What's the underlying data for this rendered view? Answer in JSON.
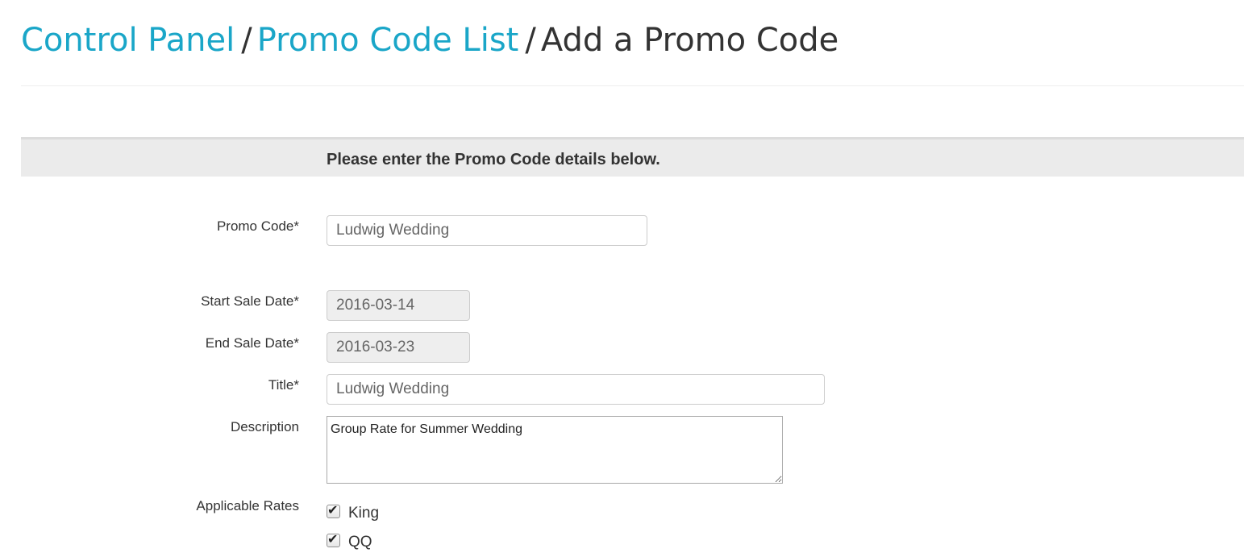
{
  "breadcrumb": {
    "control_panel": "Control Panel",
    "separator": "/",
    "promo_code_list": "Promo Code List",
    "current": "Add a Promo Code"
  },
  "section": {
    "heading": "Please enter the Promo Code details below."
  },
  "form": {
    "promo_code": {
      "label": "Promo Code*",
      "value": "Ludwig Wedding"
    },
    "start_sale_date": {
      "label": "Start Sale Date*",
      "value": "2016-03-14"
    },
    "end_sale_date": {
      "label": "End Sale Date*",
      "value": "2016-03-23"
    },
    "title": {
      "label": "Title*",
      "value": "Ludwig Wedding"
    },
    "description": {
      "label": "Description",
      "value": "Group Rate for Summer Wedding"
    },
    "applicable_rates": {
      "label": "Applicable Rates",
      "options": [
        {
          "label": "King",
          "checked": true
        },
        {
          "label": "QQ",
          "checked": true
        }
      ]
    }
  },
  "icons": {
    "check": "check-icon"
  },
  "colors": {
    "link": "#1aa6c8",
    "header_bg": "#ebebeb",
    "text": "#333333"
  }
}
